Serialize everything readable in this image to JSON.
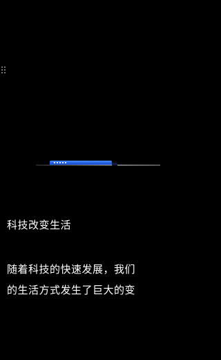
{
  "article": {
    "title": "科技改变生活",
    "caption_lines": [
      "随着科技的快速发展，我们",
      "的生活方式发生了巨大的变"
    ]
  },
  "colors": {
    "background": "#000000",
    "text": "#ffffff",
    "accent": "#1f5fe0"
  },
  "icons": {
    "handle": "drag-handle-icon"
  }
}
